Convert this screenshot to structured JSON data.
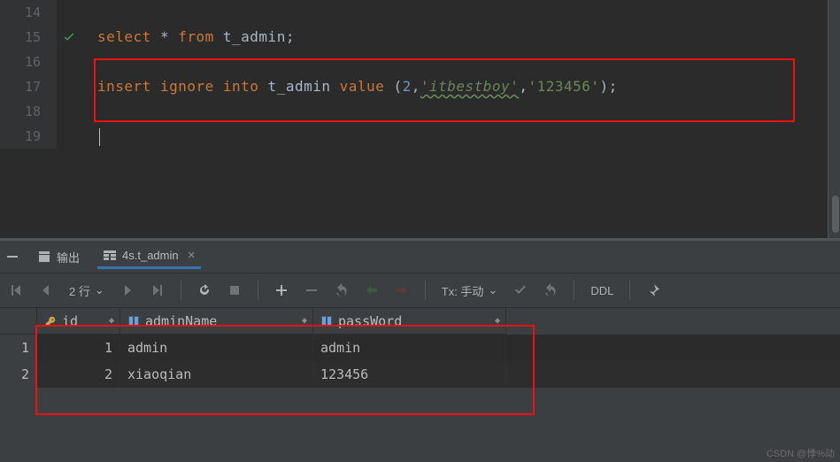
{
  "editor": {
    "lines": [
      "14",
      "15",
      "16",
      "17",
      "18",
      "19"
    ],
    "sql_select": {
      "kw1": "select",
      "star": "*",
      "kw2": "from",
      "tbl": "t_admin",
      "semi": ";"
    },
    "sql_insert": {
      "kw1": "insert",
      "kw2": "ignore",
      "kw3": "into",
      "tbl": "t_admin",
      "kw4": "value",
      "open": "(",
      "v1": "2",
      "c1": ",",
      "s1": "'itbestboy'",
      "c2": ",",
      "s2": "'123456'",
      "close": ")",
      "semi": ";"
    }
  },
  "panel": {
    "tab_output": "输出",
    "tab_table": "4s.t_admin"
  },
  "toolbar": {
    "rows_label": "2 行",
    "tx_label": "Tx: 手动",
    "ddl": "DDL"
  },
  "table": {
    "columns": {
      "id": "id",
      "name": "adminName",
      "pass": "passWord"
    },
    "rows": [
      {
        "idx": "1",
        "id": "1",
        "name": "admin",
        "pass": "admin"
      },
      {
        "idx": "2",
        "id": "2",
        "name": "xiaoqian",
        "pass": "123456"
      }
    ]
  },
  "watermark": "CSDN @悸%动"
}
